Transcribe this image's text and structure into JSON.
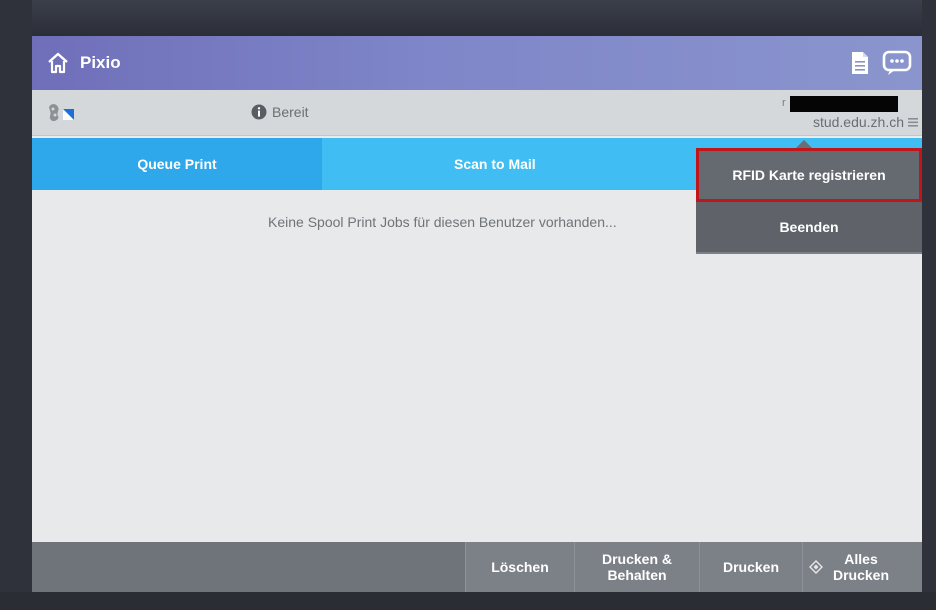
{
  "app": {
    "title": "Pixio"
  },
  "status": {
    "text": "Bereit"
  },
  "user": {
    "initial": "r",
    "domain": "stud.edu.zh.ch"
  },
  "tabs": [
    {
      "label": "Queue Print"
    },
    {
      "label": "Scan to Mail"
    }
  ],
  "content": {
    "empty_message": "Keine Spool Print Jobs für diesen Benutzer vorhanden..."
  },
  "user_menu": {
    "items": [
      {
        "label": "RFID Karte registrieren"
      },
      {
        "label": "Beenden"
      }
    ]
  },
  "actions": {
    "delete": "Löschen",
    "print_keep": [
      "Drucken &",
      "Behalten"
    ],
    "print": "Drucken",
    "print_all": [
      "Alles",
      "Drucken"
    ]
  },
  "colors": {
    "titlebar": "#7f86c9",
    "tab_active": "#2ea8ea",
    "tab_inactive": "#40bdf3",
    "highlight_border": "#c0161b"
  }
}
